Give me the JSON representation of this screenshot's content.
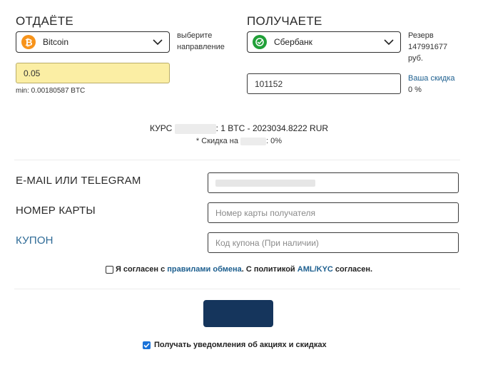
{
  "give": {
    "title": "ОТДАЁТЕ",
    "currency": "Bitcoin",
    "coin_icon": "bitcoin-icon",
    "coin_color": "#f7931a",
    "hint": "выберите направление",
    "amount": "0.05",
    "min_text": "min: 0.00180587 BTC"
  },
  "get": {
    "title": "ПОЛУЧАЕТЕ",
    "currency": "Сбербанк",
    "bank_icon": "sberbank-icon",
    "bank_color": "#21a038",
    "reserve_label": "Резерв",
    "reserve_value": "147991677",
    "reserve_unit": "руб.",
    "amount": "101152",
    "discount_label": "Ваша скидка",
    "discount_value": "0 %"
  },
  "rate": {
    "prefix": "КУРС",
    "text": ": 1 BTC - 2023034.8222 RUR",
    "discount_prefix": "* Скидка на",
    "discount_suffix": ": 0%"
  },
  "form": {
    "email_label": "E-MAIL ИЛИ TELEGRAM",
    "card_label": "НОМЕР КАРТЫ",
    "card_placeholder": "Номер карты получателя",
    "coupon_label": "КУПОН",
    "coupon_placeholder": "Код купона (При наличии)"
  },
  "agree": {
    "prefix": "Я согласен с",
    "rules_link": "правилами обмена",
    "middle": ". С политикой",
    "aml_link": "AML/KYC",
    "suffix": "согласен."
  },
  "notify": {
    "label": "Получать уведомления об акциях и скидках",
    "checked": true
  },
  "colors": {
    "accent": "#15355c",
    "link": "#1d5f8f",
    "amount_bg": "#fbeea4"
  }
}
